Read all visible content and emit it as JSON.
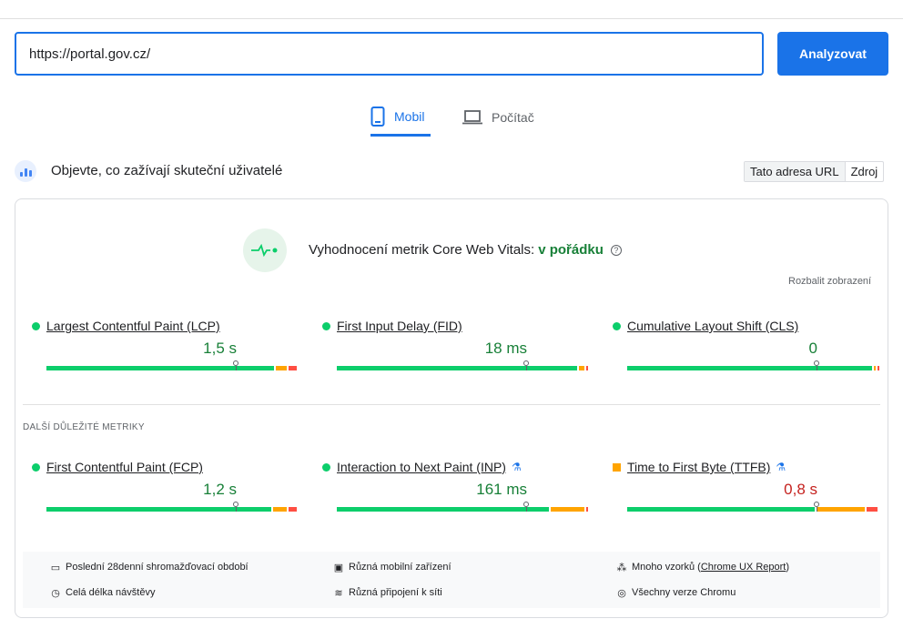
{
  "url_input": {
    "value": "https://portal.gov.cz/"
  },
  "analyze_button": {
    "label": "Analyzovat"
  },
  "tabs": {
    "mobile": "Mobil",
    "desktop": "Počítač"
  },
  "field_section": {
    "title": "Objevte, co zažívají skuteční uživatelé",
    "toggle": {
      "this_url": "Tato adresa URL",
      "origin": "Zdroj"
    }
  },
  "cwv": {
    "label": "Vyhodnocení metrik Core Web Vitals:",
    "status": "v pořádku",
    "expand": "Rozbalit zobrazení"
  },
  "metrics": {
    "lcp": {
      "name": "Largest Contentful Paint (LCP)",
      "value": "1,5 s",
      "rating": "good",
      "distribution": [
        0.91,
        0.05,
        0.04
      ],
      "marker": 0.75
    },
    "fid": {
      "name": "First Input Delay (FID)",
      "value": "18 ms",
      "rating": "good",
      "distribution": [
        0.96,
        0.03,
        0.01
      ],
      "marker": 0.75
    },
    "cls": {
      "name": "Cumulative Layout Shift (CLS)",
      "value": "0",
      "rating": "good",
      "distribution": [
        0.98,
        0.01,
        0.01
      ],
      "marker": 0.75
    }
  },
  "other": {
    "title": "DALŠÍ DŮLEŽITÉ METRIKY",
    "fcp": {
      "name": "First Contentful Paint (FCP)",
      "value": "1,2 s",
      "rating": "good",
      "distribution": [
        0.9,
        0.06,
        0.04
      ],
      "marker": 0.75
    },
    "inp": {
      "name": "Interaction to Next Paint (INP)",
      "value": "161 ms",
      "rating": "good",
      "distribution": [
        0.85,
        0.14,
        0.01
      ],
      "marker": 0.75
    },
    "ttfb": {
      "name": "Time to First Byte (TTFB)",
      "value": "0,8 s",
      "rating": "average",
      "distribution": [
        0.75,
        0.2,
        0.05
      ],
      "marker": 0.75
    }
  },
  "footer": {
    "period": "Poslední 28denní shromažďovací období",
    "devices": "Různá mobilní zařízení",
    "samples_prefix": "Mnoho vzorků (",
    "samples_link": "Chrome UX Report",
    "samples_suffix": ")",
    "duration": "Celá délka návštěvy",
    "network": "Různá připojení k síti",
    "chrome": "Všechny verze Chromu"
  },
  "colors": {
    "accent": "#1a73e8",
    "good": "#0cce6b",
    "average": "#ffa400",
    "poor": "#ff4e42",
    "good_text": "#188038",
    "avg_text": "#c5221f"
  }
}
